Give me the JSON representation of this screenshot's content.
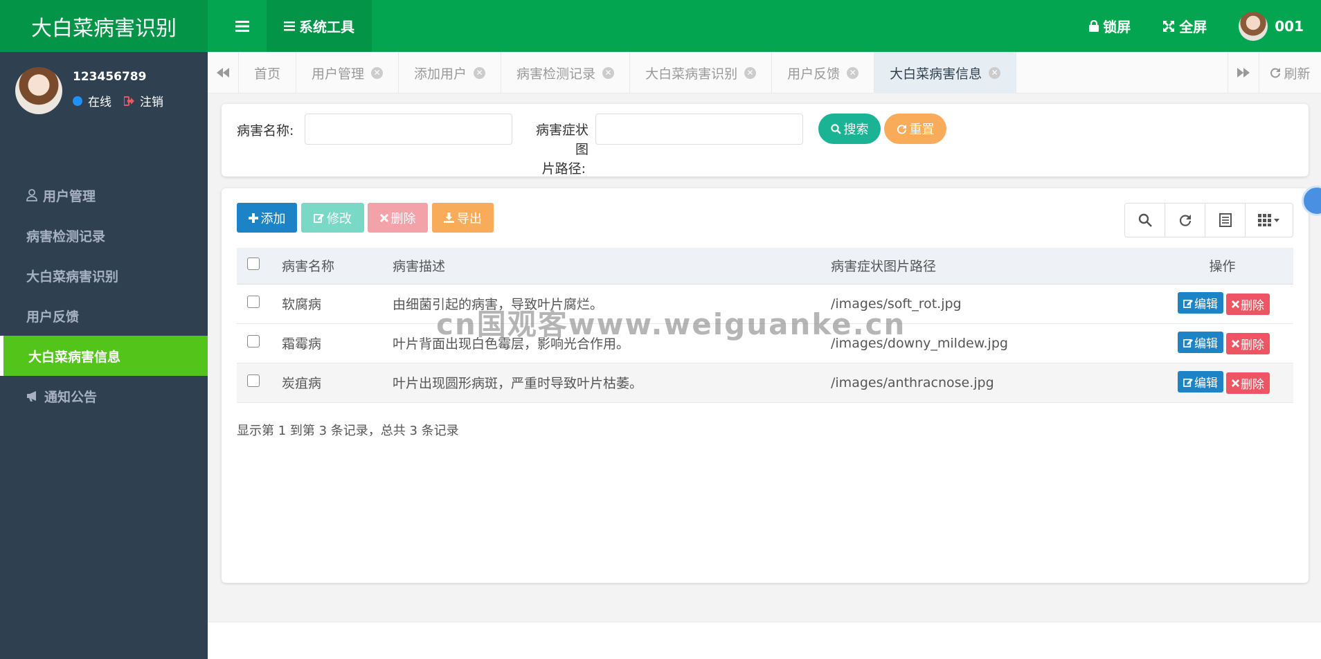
{
  "app": {
    "title": "大白菜病害识别",
    "systool_label": "系统工具",
    "lock_label": "锁屏",
    "fullscreen_label": "全屏",
    "user_label": "001"
  },
  "user": {
    "name": "123456789",
    "online_label": "在线",
    "logout_label": "注销"
  },
  "sidebar": {
    "items": [
      {
        "label": "用户管理",
        "icon": "user-icon"
      },
      {
        "label": "病害检测记录"
      },
      {
        "label": "大白菜病害识别"
      },
      {
        "label": "用户反馈"
      },
      {
        "label": "大白菜病害信息",
        "active": true
      },
      {
        "label": "通知公告",
        "icon": "bullhorn-icon"
      }
    ]
  },
  "tabs": [
    {
      "label": "首页",
      "closable": false
    },
    {
      "label": "用户管理",
      "closable": true
    },
    {
      "label": "添加用户",
      "closable": true
    },
    {
      "label": "病害检测记录",
      "closable": true
    },
    {
      "label": "大白菜病害识别",
      "closable": true
    },
    {
      "label": "用户反馈",
      "closable": true
    },
    {
      "label": "大白菜病害信息",
      "closable": true,
      "active": true
    }
  ],
  "refresh_label": "刷新",
  "search": {
    "name_label": "病害名称:",
    "name_value": "",
    "path_label_line1": "病害症状图",
    "path_label_line2": "片路径:",
    "path_value": "",
    "search_label": "搜索",
    "reset_label": "重置"
  },
  "toolbar": {
    "add_label": "添加",
    "edit_label": "修改",
    "delete_label": "删除",
    "export_label": "导出"
  },
  "table": {
    "headers": [
      "病害名称",
      "病害描述",
      "病害症状图片路径",
      "操作"
    ],
    "rows": [
      {
        "name": "软腐病",
        "desc": "由细菌引起的病害，导致叶片腐烂。",
        "path": "/images/soft_rot.jpg"
      },
      {
        "name": "霜霉病",
        "desc": "叶片背面出现白色霉层，影响光合作用。",
        "path": "/images/downy_mildew.jpg"
      },
      {
        "name": "炭疽病",
        "desc": "叶片出现圆形病斑，严重时导致叶片枯萎。",
        "path": "/images/anthracnose.jpg"
      }
    ],
    "edit_label": "编辑",
    "delete_label": "删除"
  },
  "page_info": "显示第 1 到第 3 条记录，总共 3 条记录",
  "watermark": "cn国观客www.weiguanke.cn",
  "colors": {
    "brand": "#04a550",
    "sidebar": "#2f4050",
    "active": "#52c41a",
    "primary": "#1c84c6",
    "danger": "#ed5565",
    "warning": "#f8ac59",
    "teal": "#1ab394"
  }
}
